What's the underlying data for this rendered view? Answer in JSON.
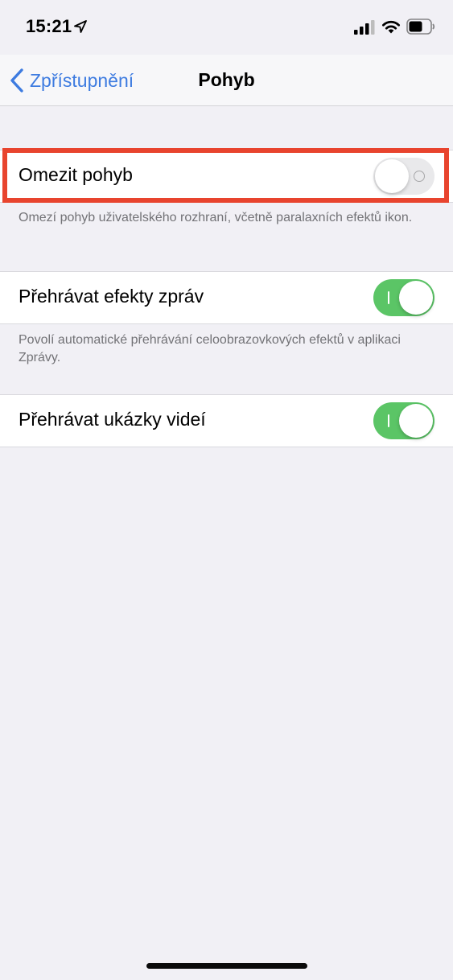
{
  "status_bar": {
    "time": "15:21",
    "icons": [
      "location-arrow-icon",
      "cellular-signal-icon",
      "wifi-icon",
      "battery-icon"
    ]
  },
  "nav": {
    "back_label": "Zpřístupnění",
    "title": "Pohyb"
  },
  "settings": [
    {
      "label": "Omezit pohyb",
      "toggle_state": "off",
      "footer": "Omezí pohyb uživatelského rozhraní, včetně paralaxních efektů ikon."
    },
    {
      "label": "Přehrávat efekty zpráv",
      "toggle_state": "on",
      "footer": "Povolí automatické přehrávání celoobrazovkových efektů v aplikaci Zprávy."
    },
    {
      "label": "Přehrávat ukázky videí",
      "toggle_state": "on"
    }
  ],
  "colors": {
    "background": "#f1f0f5",
    "accent_blue": "#3d7be0",
    "toggle_on": "#5bc566",
    "toggle_off": "#e9e9eb",
    "highlight_box": "#e8442e",
    "footer_text": "#727276"
  }
}
